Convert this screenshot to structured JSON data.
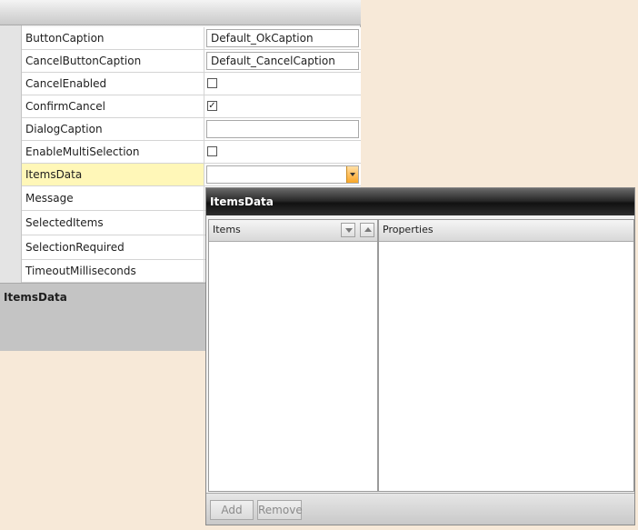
{
  "property_grid": {
    "rows": [
      {
        "name": "ButtonCaption",
        "value": "Default_OkCaption"
      },
      {
        "name": "CancelButtonCaption",
        "value": "Default_CancelCaption"
      },
      {
        "name": "CancelEnabled",
        "checked": false
      },
      {
        "name": "ConfirmCancel",
        "checked": true,
        "check_glyph": "✓"
      },
      {
        "name": "DialogCaption",
        "value": ""
      },
      {
        "name": "EnableMultiSelection",
        "checked": false
      },
      {
        "name": "ItemsData",
        "value": "",
        "selected": true
      },
      {
        "name": "Message"
      },
      {
        "name": "SelectedItems"
      },
      {
        "name": "SelectionRequired"
      },
      {
        "name": "TimeoutMilliseconds"
      }
    ],
    "description_title": "ItemsData"
  },
  "popup": {
    "title": "ItemsData",
    "items_header": "Items",
    "properties_header": "Properties",
    "add_label": "Add",
    "remove_label": "Remove"
  },
  "colors": {
    "background": "#f7e9d8",
    "selected_row": "#fff7b8",
    "dropdown_button": "#ffc060"
  }
}
